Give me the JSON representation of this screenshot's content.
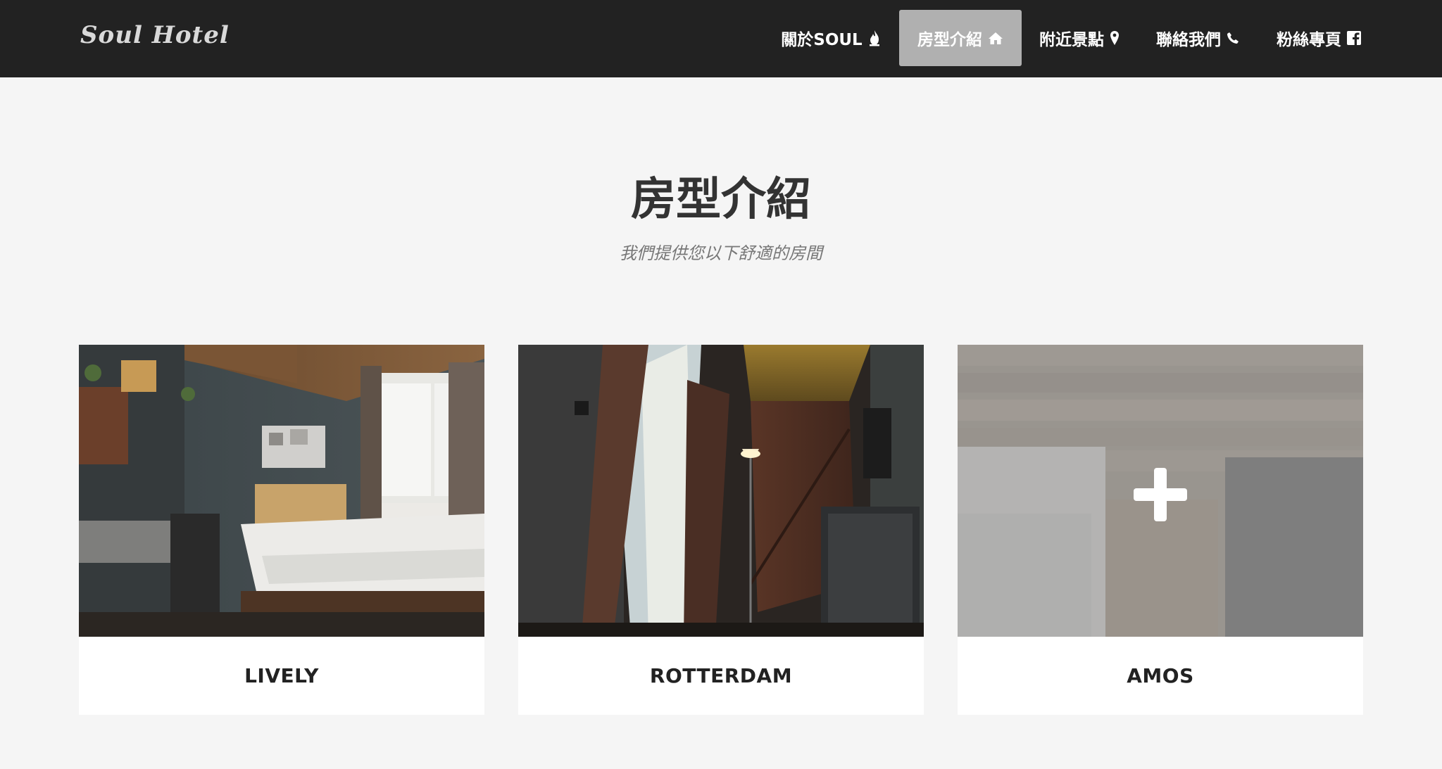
{
  "brand": "Soul Hotel",
  "nav": {
    "items": [
      {
        "label": "關於SOUL",
        "icon": "fire-icon",
        "active": false
      },
      {
        "label": "房型介紹",
        "icon": "home-icon",
        "active": true
      },
      {
        "label": "附近景點",
        "icon": "map-marker-icon",
        "active": false
      },
      {
        "label": "聯絡我們",
        "icon": "phone-icon",
        "active": false
      },
      {
        "label": "粉絲專頁",
        "icon": "facebook-icon",
        "active": false
      }
    ]
  },
  "section": {
    "title": "房型介紹",
    "subtitle": "我們提供您以下舒適的房間"
  },
  "rooms": [
    {
      "name": "LIVELY",
      "hover": false
    },
    {
      "name": "ROTTERDAM",
      "hover": false
    },
    {
      "name": "AMOS",
      "hover": true,
      "hover_icon": "plus-icon"
    }
  ],
  "colors": {
    "navbar_bg": "#222222",
    "active_nav_bg": "#b0b0b0",
    "page_bg": "#f5f5f5",
    "heading": "#333333",
    "subheading": "#777777"
  }
}
